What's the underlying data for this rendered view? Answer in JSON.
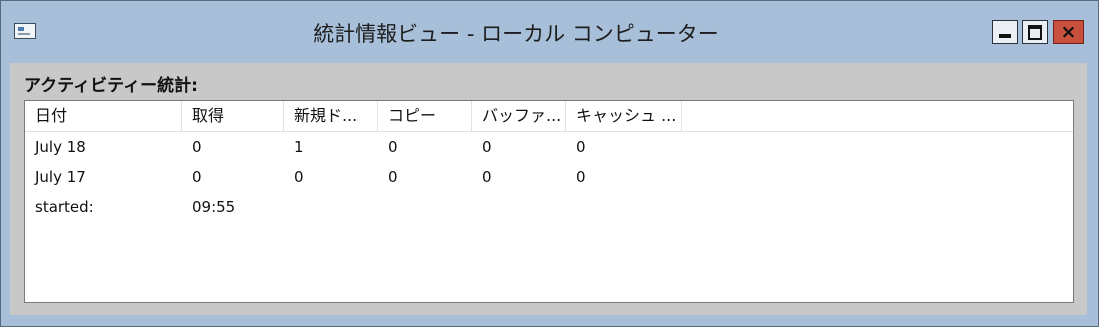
{
  "window": {
    "title": "統計情報ビュー - ローカル コンピューター",
    "icon": "app-window-icon",
    "controls": {
      "minimize": "minimize-icon",
      "maximize": "maximize-icon",
      "close": "×"
    }
  },
  "group_label": "アクティビティー統計:",
  "table": {
    "columns": [
      "日付",
      "取得",
      "新規ド...",
      "コピー",
      "バッファ...",
      "キャッシュ ..."
    ],
    "rows": [
      [
        "July 18",
        "0",
        "1",
        "0",
        "0",
        "0"
      ],
      [
        "July 17",
        "0",
        "0",
        "0",
        "0",
        "0"
      ],
      [
        "started:",
        "09:55",
        "",
        "",
        "",
        ""
      ]
    ]
  }
}
